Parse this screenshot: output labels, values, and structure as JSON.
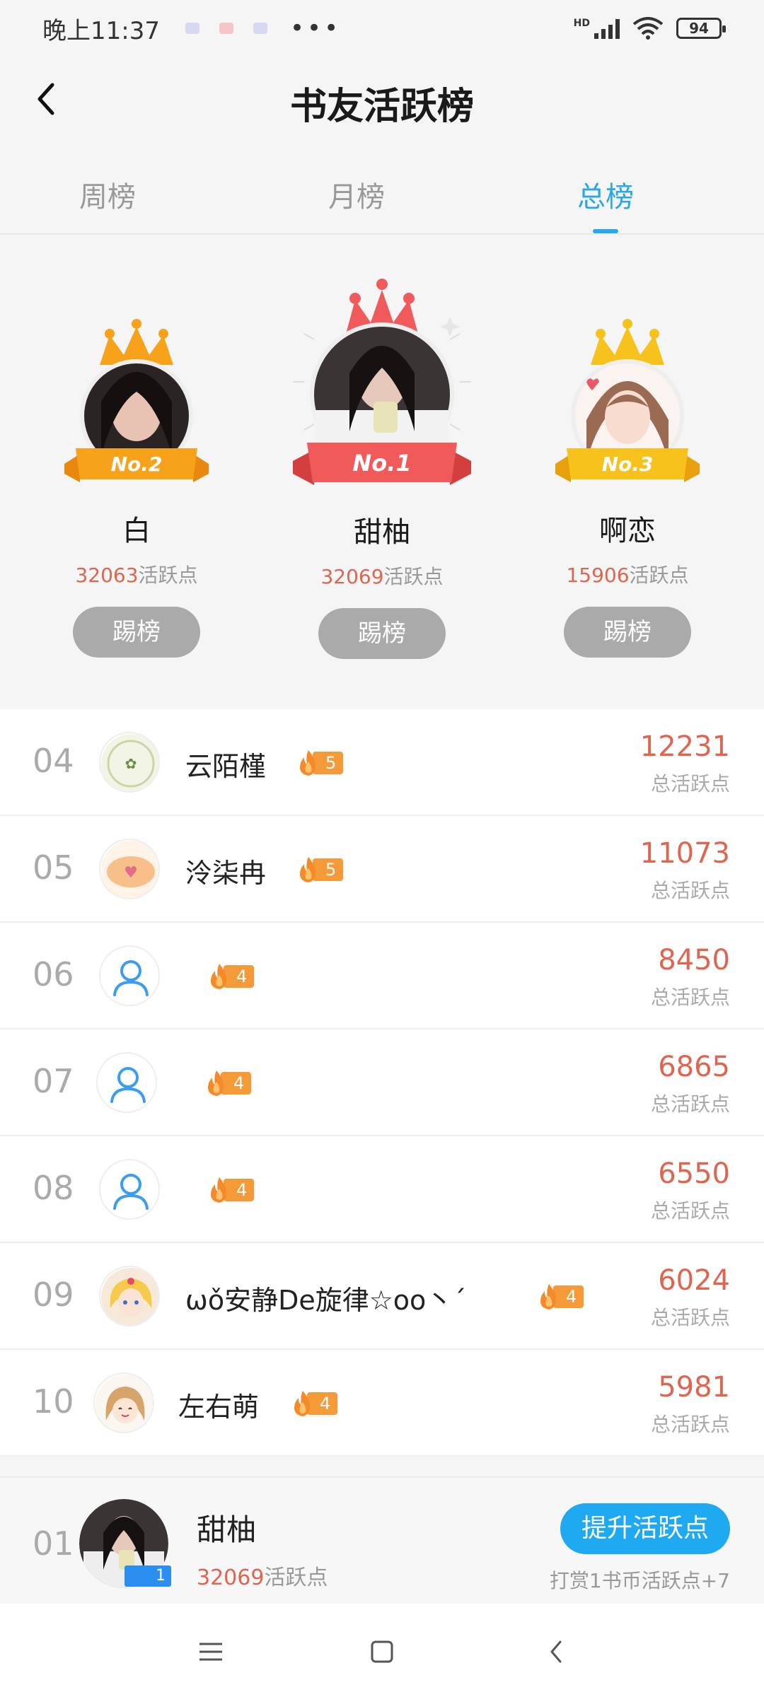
{
  "status": {
    "time": "晚上11:37",
    "more": "•••",
    "battery": "94",
    "network": "HD"
  },
  "header": {
    "title": "书友活跃榜"
  },
  "tabs": [
    {
      "label": "周榜"
    },
    {
      "label": "月榜"
    },
    {
      "label": "总榜"
    }
  ],
  "podium": {
    "first": {
      "name": "甜柚",
      "score": "32069",
      "unit": "活跃点",
      "badge": "No.1",
      "kick": "踢榜"
    },
    "second": {
      "name": "白",
      "score": "32063",
      "unit": "活跃点",
      "badge": "No.2",
      "kick": "踢榜"
    },
    "third": {
      "name": "啊恋",
      "score": "15906",
      "unit": "活跃点",
      "badge": "No.3",
      "kick": "踢榜"
    }
  },
  "list": [
    {
      "rank": "04",
      "name": "云陌槿",
      "level": "5",
      "score": "12231",
      "label": "总活跃点"
    },
    {
      "rank": "05",
      "name": "泠柒冉",
      "level": "5",
      "score": "11073",
      "label": "总活跃点"
    },
    {
      "rank": "06",
      "name": "",
      "level": "4",
      "score": "8450",
      "label": "总活跃点"
    },
    {
      "rank": "07",
      "name": "",
      "level": "4",
      "score": "6865",
      "label": "总活跃点"
    },
    {
      "rank": "08",
      "name": "",
      "level": "4",
      "score": "6550",
      "label": "总活跃点"
    },
    {
      "rank": "09",
      "name": "ωǒ安静De旋律☆oo丶ˊ",
      "level": "4",
      "score": "6024",
      "label": "总活跃点"
    },
    {
      "rank": "10",
      "name": "左右萌",
      "level": "4",
      "score": "5981",
      "label": "总活跃点"
    }
  ],
  "me": {
    "rank": "01",
    "name": "甜柚",
    "score": "32069",
    "unit": "活跃点",
    "level": "1",
    "button": "提升活跃点",
    "tip": "打赏1书币活跃点+7"
  },
  "colors": {
    "accent": "#2aa8e6",
    "score": "#e0654f",
    "gold": "#f7a21b",
    "red": "#f05a5a",
    "yellow": "#f7c21b"
  }
}
